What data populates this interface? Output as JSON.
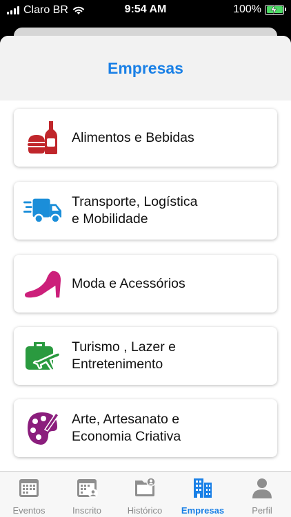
{
  "status_bar": {
    "carrier": "Claro BR",
    "time": "9:54 AM",
    "battery": "100%"
  },
  "header": {
    "title": "Empresas"
  },
  "categories": [
    {
      "label_line1": "Alimentos e Bebidas",
      "label_line2": "",
      "icon": "food-drink-icon",
      "color": "#c0262b"
    },
    {
      "label_line1": "Transporte, Logística",
      "label_line2": "e Mobilidade",
      "icon": "delivery-truck-icon",
      "color": "#1b8ed9"
    },
    {
      "label_line1": "Moda e Acessórios",
      "label_line2": "",
      "icon": "high-heel-icon",
      "color": "#cc1f7a"
    },
    {
      "label_line1": "Turismo , Lazer e",
      "label_line2": "Entretenimento",
      "icon": "travel-bag-icon",
      "color": "#2a9a3f"
    },
    {
      "label_line1": "Arte, Artesanato e",
      "label_line2": "Economia Criativa",
      "icon": "palette-icon",
      "color": "#8b1e7d"
    }
  ],
  "tabs": [
    {
      "label": "Eventos",
      "icon": "calendar-icon"
    },
    {
      "label": "Inscrito",
      "icon": "calendar-user-icon"
    },
    {
      "label": "Histórico",
      "icon": "folder-user-icon"
    },
    {
      "label": "Empresas",
      "icon": "buildings-icon"
    },
    {
      "label": "Perfil",
      "icon": "person-icon"
    }
  ],
  "colors": {
    "accent": "#1a80e6",
    "inactive_tab": "#8a8a8a"
  }
}
